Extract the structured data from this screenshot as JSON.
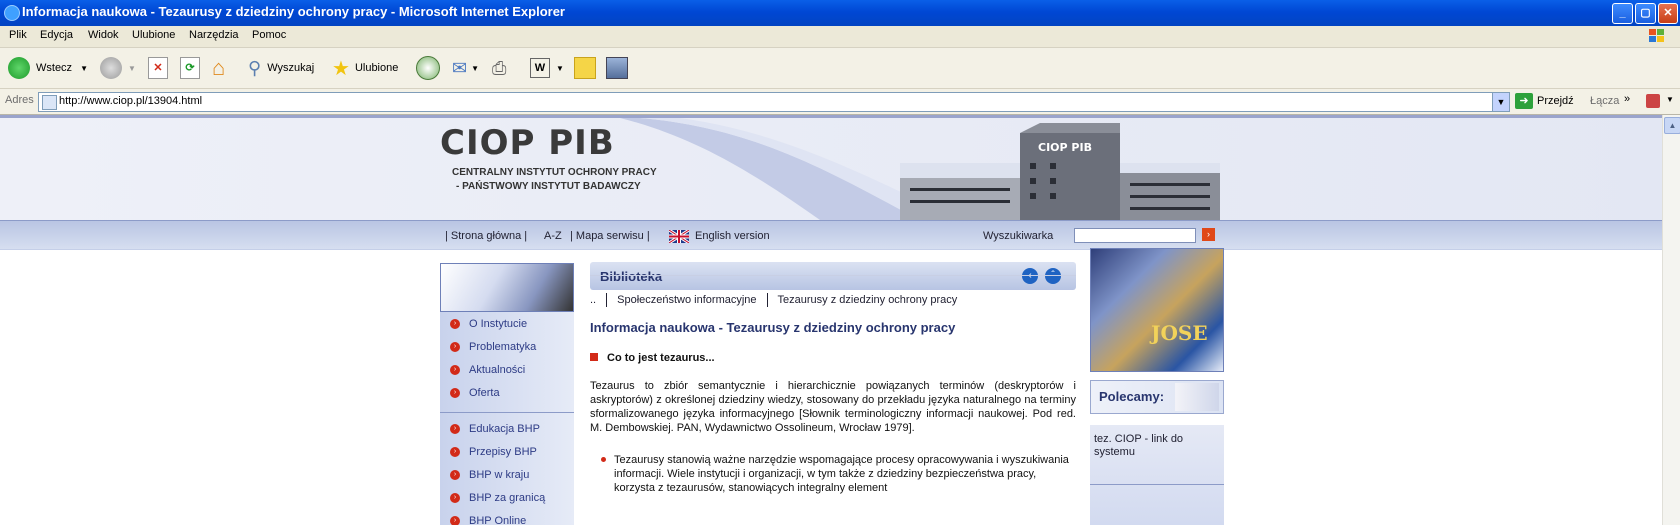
{
  "window": {
    "title": "Informacja naukowa - Tezaurusy z dziedziny ochrony pracy - Microsoft Internet Explorer"
  },
  "menu": [
    "Plik",
    "Edycja",
    "Widok",
    "Ulubione",
    "Narzędzia",
    "Pomoc"
  ],
  "toolbar": {
    "back_label": "Wstecz",
    "search_label": "Wyszukaj",
    "favorites_label": "Ulubione"
  },
  "address_bar": {
    "label": "Adres",
    "url": "http://www.ciop.pl/13904.html",
    "go_label": "Przejdź",
    "links_label": "Łącza"
  },
  "site": {
    "logo_text": "CIOP PIB",
    "subtitle_line1": "CENTRALNY INSTYTUT OCHRONY PRACY",
    "subtitle_line2": "- PAŃSTWOWY INSTYTUT BADAWCZY",
    "building_sign": "CIOP PIB",
    "nav": {
      "home": "| Strona główna |",
      "az": "A-Z",
      "sitemap": "| Mapa serwisu |",
      "english": "English version",
      "search_label": "Wyszukiwarka"
    },
    "left_nav": {
      "group1": [
        "O Instytucie",
        "Problematyka",
        "Aktualności",
        "Oferta"
      ],
      "group2": [
        "Edukacja BHP",
        "Przepisy BHP",
        "BHP w kraju",
        "BHP za granicą",
        "BHP Online"
      ]
    },
    "main": {
      "section_header": "Biblioteka",
      "breadcrumb": [
        "..",
        "Społeczeństwo informacyjne",
        "Tezaurusy z dziedziny ochrony pracy"
      ],
      "page_title": "Informacja naukowa - Tezaurusy z dziedziny ochrony pracy",
      "subheading": "Co to jest tezaurus...",
      "paragraph": "Tezaurus to zbiór semantycznie i hierarchicznie powiązanych terminów (deskryptorów i askryptorów) z określonej dziedziny wiedzy, stosowany do przekładu języka naturalnego na terminy sformalizowanego języka informacyjnego [Słownik terminologiczny informacji naukowej. Pod red. M. Dembowskiej. PAN, Wydawnictwo Ossolineum, Wrocław 1979].",
      "bullet1": "Tezaurusy stanowią ważne narzędzie wspomagające procesy opracowywania i wyszukiwania informacji. Wiele instytucji i organizacji, w tym także z dziedziny bezpieczeństwa pracy, korzysta z tezaurusów, stanowiących integralny element"
    },
    "right": {
      "journal_title": "JOSE",
      "polecamy": "Polecamy:",
      "link_text": "tez. CIOP - link do systemu"
    }
  }
}
